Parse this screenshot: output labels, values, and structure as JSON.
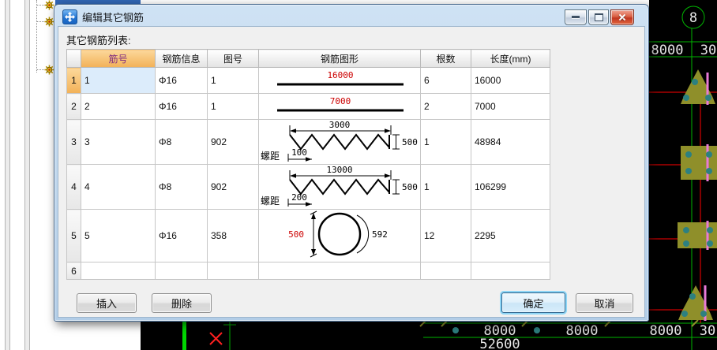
{
  "window": {
    "title": "编辑其它钢筋",
    "controls": {
      "minimize": "minimize-icon",
      "maximize": "maximize-icon",
      "close": "close-icon"
    }
  },
  "dialog": {
    "list_label": "其它钢筋列表:",
    "table": {
      "headers": [
        "",
        "筋号",
        "钢筋信息",
        "图号",
        "钢筋图形",
        "根数",
        "长度(mm)"
      ],
      "rows": [
        {
          "num": "1",
          "id": "1",
          "info": "Φ16",
          "fig": "1",
          "count": "6",
          "length": "16000",
          "shape": {
            "type": "line",
            "label": "16000"
          }
        },
        {
          "num": "2",
          "id": "2",
          "info": "Φ16",
          "fig": "1",
          "count": "2",
          "length": "7000",
          "shape": {
            "type": "line",
            "label": "7000"
          }
        },
        {
          "num": "3",
          "id": "3",
          "info": "Φ8",
          "fig": "902",
          "count": "1",
          "length": "48984",
          "shape": {
            "type": "spiral",
            "top": "3000",
            "height": "500",
            "pitch_label": "螺距",
            "pitch": "100"
          }
        },
        {
          "num": "4",
          "id": "4",
          "info": "Φ8",
          "fig": "902",
          "count": "1",
          "length": "106299",
          "shape": {
            "type": "spiral",
            "top": "13000",
            "height": "500",
            "pitch_label": "螺距",
            "pitch": "200"
          }
        },
        {
          "num": "5",
          "id": "5",
          "info": "Φ16",
          "fig": "358",
          "count": "12",
          "length": "2295",
          "shape": {
            "type": "circle",
            "diameter": "500",
            "arc": "592"
          }
        },
        {
          "num": "6",
          "id": "",
          "info": "",
          "fig": "",
          "count": "",
          "length": ""
        }
      ]
    },
    "buttons": {
      "insert": "插入",
      "delete": "删除",
      "ok": "确定",
      "cancel": "取消"
    }
  },
  "cad": {
    "axis_bubble_label": "8",
    "right_dim_labels": [
      "8000",
      "30"
    ],
    "bottom_dim_labels": [
      "8000",
      "8000",
      "8000",
      "30"
    ],
    "bottom_total_label": "52600"
  },
  "colors": {
    "dimension_red": "#cc0000",
    "cad_green": "#00b400",
    "cad_background": "#000000",
    "selected_cell_blue": "#dcecfb",
    "selected_header_orange": "#f2b158"
  }
}
